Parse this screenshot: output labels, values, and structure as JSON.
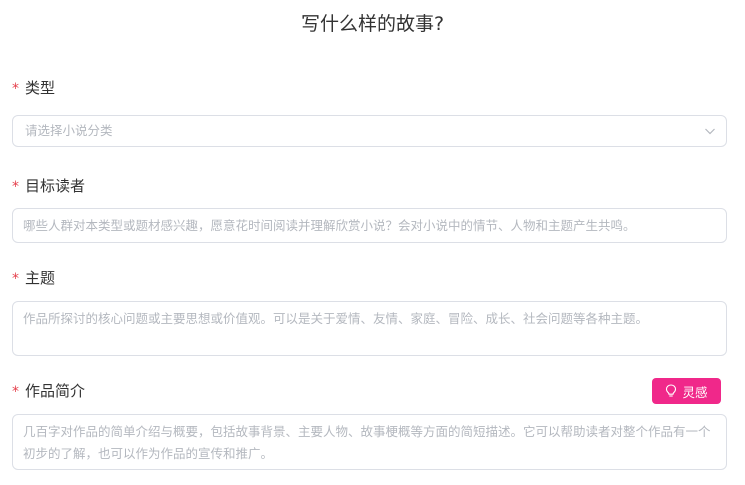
{
  "page": {
    "title": "写什么样的故事?"
  },
  "form": {
    "genre": {
      "required_mark": "*",
      "label": "类型",
      "placeholder": "请选择小说分类"
    },
    "audience": {
      "required_mark": "*",
      "label": "目标读者",
      "placeholder": "哪些人群对本类型或题材感兴趣，愿意花时间阅读并理解欣赏小说？会对小说中的情节、人物和主题产生共鸣。"
    },
    "theme": {
      "required_mark": "*",
      "label": "主题",
      "placeholder": "作品所探讨的核心问题或主要思想或价值观。可以是关于爱情、友情、家庭、冒险、成长、社会问题等各种主题。"
    },
    "synopsis": {
      "required_mark": "*",
      "label": "作品简介",
      "placeholder": "几百字对作品的简单介绍与概要，包括故事背景、主要人物、故事梗概等方面的简短描述。它可以帮助读者对整个作品有一个初步的了解，也可以作为作品的宣传和推广。",
      "inspire_button": {
        "label": "灵感",
        "icon": "lightbulb-icon",
        "color": "#f0288a"
      }
    }
  },
  "colors": {
    "required": "#e5404c",
    "accent": "#f0288a",
    "border": "#dcdfe6",
    "placeholder": "#b4b8bf"
  }
}
